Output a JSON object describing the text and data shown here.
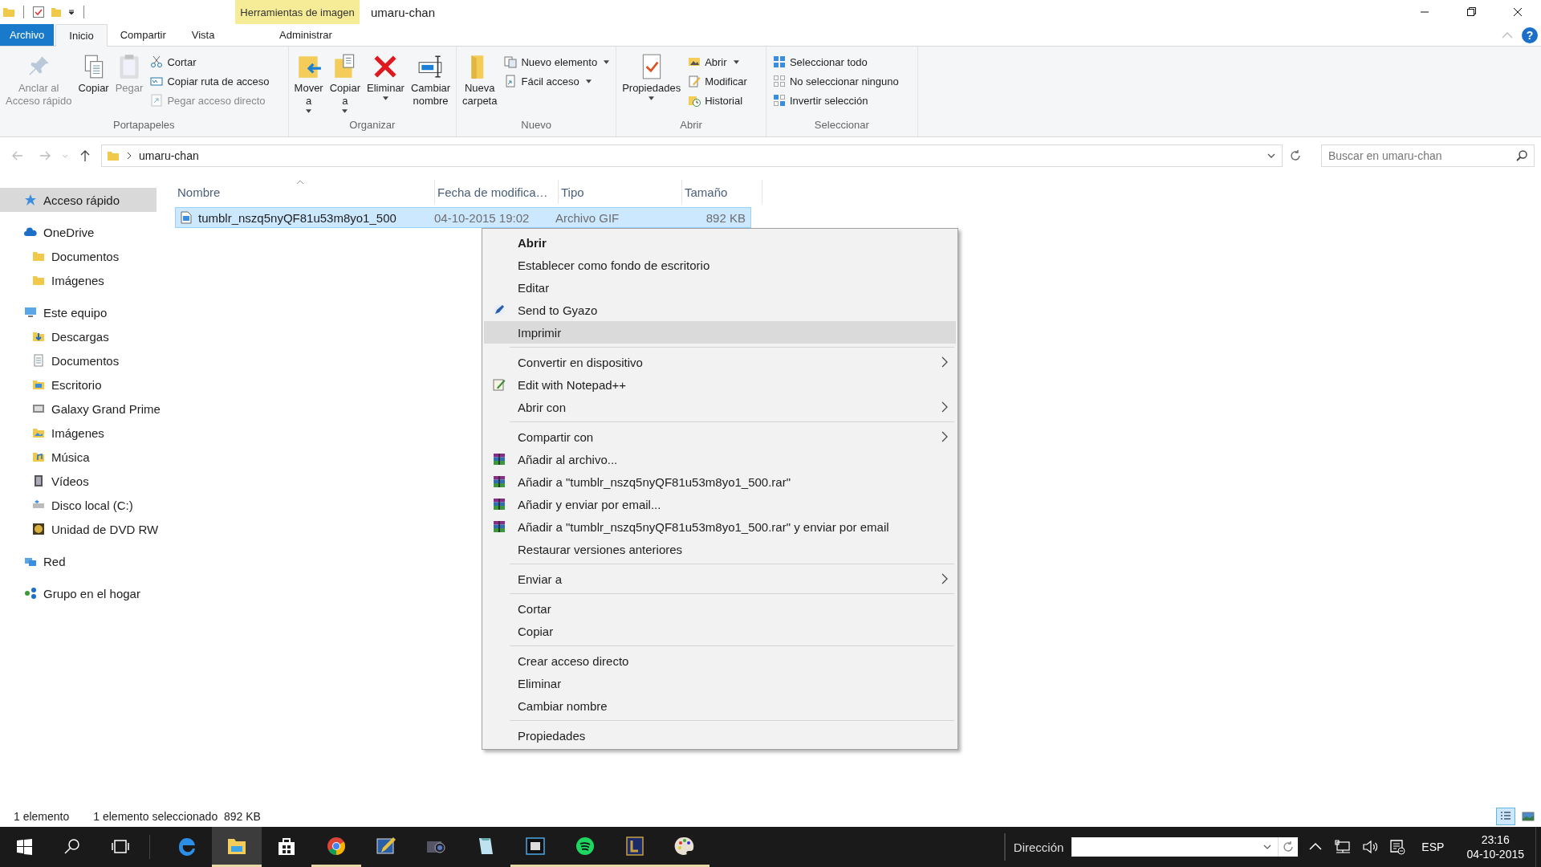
{
  "window": {
    "title": "umaru-chan",
    "context_tab_header": "Herramientas de imagen",
    "help_label": "?"
  },
  "ribbon_tabs": [
    {
      "label": "Archivo",
      "kind": "file",
      "selected": false
    },
    {
      "label": "Inicio",
      "kind": "tab",
      "selected": true
    },
    {
      "label": "Compartir",
      "kind": "tab",
      "selected": false
    },
    {
      "label": "Vista",
      "kind": "tab",
      "selected": false
    },
    {
      "label": "Administrar",
      "kind": "context",
      "selected": false
    }
  ],
  "ribbon_groups": [
    {
      "label": "Portapapeles",
      "large": [
        {
          "label": "Anclar al\nAcceso rápido",
          "disabled": true,
          "dropdown": false
        },
        {
          "label": "Copiar",
          "disabled": false,
          "dropdown": false
        },
        {
          "label": "Pegar",
          "disabled": true,
          "dropdown": false
        }
      ],
      "small": [
        {
          "label": "Cortar",
          "disabled": false,
          "dropdown": false
        },
        {
          "label": "Copiar ruta de acceso",
          "disabled": false,
          "dropdown": false
        },
        {
          "label": "Pegar acceso directo",
          "disabled": true,
          "dropdown": false
        }
      ]
    },
    {
      "label": "Organizar",
      "large": [
        {
          "label": "Mover\na",
          "disabled": false,
          "dropdown": true
        },
        {
          "label": "Copiar\na",
          "disabled": false,
          "dropdown": true
        },
        {
          "label": "Eliminar",
          "disabled": false,
          "dropdown": true
        },
        {
          "label": "Cambiar\nnombre",
          "disabled": false,
          "dropdown": false
        }
      ]
    },
    {
      "label": "Nuevo",
      "large": [
        {
          "label": "Nueva\ncarpeta",
          "disabled": false,
          "dropdown": false
        }
      ],
      "small": [
        {
          "label": "Nuevo elemento",
          "disabled": false,
          "dropdown": true
        },
        {
          "label": "Fácil acceso",
          "disabled": false,
          "dropdown": true
        }
      ]
    },
    {
      "label": "Abrir",
      "large": [
        {
          "label": "Propiedades",
          "disabled": false,
          "dropdown": true
        }
      ],
      "small": [
        {
          "label": "Abrir",
          "disabled": false,
          "dropdown": true
        },
        {
          "label": "Modificar",
          "disabled": false,
          "dropdown": false
        },
        {
          "label": "Historial",
          "disabled": false,
          "dropdown": false
        }
      ]
    },
    {
      "label": "Seleccionar",
      "small": [
        {
          "label": "Seleccionar todo",
          "disabled": false,
          "dropdown": false
        },
        {
          "label": "No seleccionar ninguno",
          "disabled": false,
          "dropdown": false
        },
        {
          "label": "Invertir selección",
          "disabled": false,
          "dropdown": false
        }
      ]
    }
  ],
  "address_bar": {
    "path": "umaru-chan",
    "search_placeholder": "Buscar en umaru-chan"
  },
  "sidebar": {
    "items": [
      {
        "label": "Acceso rápido",
        "selected": true
      },
      {
        "label": "OneDrive",
        "selected": false,
        "children": [
          {
            "label": "Documentos",
            "selected": false
          },
          {
            "label": "Imágenes",
            "selected": false
          }
        ]
      },
      {
        "label": "Este equipo",
        "selected": false,
        "children": [
          {
            "label": "Descargas",
            "selected": false
          },
          {
            "label": "Documentos",
            "selected": false
          },
          {
            "label": "Escritorio",
            "selected": false
          },
          {
            "label": "Galaxy Grand Prime",
            "selected": false
          },
          {
            "label": "Imágenes",
            "selected": false
          },
          {
            "label": "Música",
            "selected": false
          },
          {
            "label": "Vídeos",
            "selected": false
          },
          {
            "label": "Disco local (C:)",
            "selected": false
          },
          {
            "label": "Unidad de DVD RW",
            "selected": false
          }
        ]
      },
      {
        "label": "Red",
        "selected": false
      },
      {
        "label": "Grupo en el hogar",
        "selected": false
      }
    ]
  },
  "file_list": {
    "columns": [
      "Nombre",
      "Fecha de modifica…",
      "Tipo",
      "Tamaño"
    ],
    "rows": [
      {
        "name": "tumblr_nszq5nyQF81u53m8yo1_500",
        "date": "04-10-2015 19:02",
        "type": "Archivo GIF",
        "size": "892 KB",
        "selected": true
      }
    ]
  },
  "context_menu": [
    {
      "kind": "item",
      "label": "Abrir",
      "bold": true,
      "submenu": false,
      "highlighted": false
    },
    {
      "kind": "item",
      "label": "Establecer como fondo de escritorio",
      "bold": false,
      "submenu": false,
      "highlighted": false
    },
    {
      "kind": "item",
      "label": "Editar",
      "bold": false,
      "submenu": false,
      "highlighted": false
    },
    {
      "kind": "item",
      "label": "Send to Gyazo",
      "bold": false,
      "submenu": false,
      "highlighted": false
    },
    {
      "kind": "item",
      "label": "Imprimir",
      "bold": false,
      "submenu": false,
      "highlighted": true
    },
    {
      "kind": "separator"
    },
    {
      "kind": "item",
      "label": "Convertir en dispositivo",
      "bold": false,
      "submenu": true,
      "highlighted": false
    },
    {
      "kind": "item",
      "label": "Edit with Notepad++",
      "bold": false,
      "submenu": false,
      "highlighted": false
    },
    {
      "kind": "item",
      "label": "Abrir con",
      "bold": false,
      "submenu": true,
      "highlighted": false
    },
    {
      "kind": "separator"
    },
    {
      "kind": "item",
      "label": "Compartir con",
      "bold": false,
      "submenu": true,
      "highlighted": false
    },
    {
      "kind": "item",
      "label": "Añadir al archivo...",
      "bold": false,
      "submenu": false,
      "highlighted": false
    },
    {
      "kind": "item",
      "label": "Añadir a \"tumblr_nszq5nyQF81u53m8yo1_500.rar\"",
      "bold": false,
      "submenu": false,
      "highlighted": false
    },
    {
      "kind": "item",
      "label": "Añadir y enviar por email...",
      "bold": false,
      "submenu": false,
      "highlighted": false
    },
    {
      "kind": "item",
      "label": "Añadir a \"tumblr_nszq5nyQF81u53m8yo1_500.rar\" y enviar por email",
      "bold": false,
      "submenu": false,
      "highlighted": false
    },
    {
      "kind": "item",
      "label": "Restaurar versiones anteriores",
      "bold": false,
      "submenu": false,
      "highlighted": false
    },
    {
      "kind": "separator"
    },
    {
      "kind": "item",
      "label": "Enviar a",
      "bold": false,
      "submenu": true,
      "highlighted": false
    },
    {
      "kind": "separator"
    },
    {
      "kind": "item",
      "label": "Cortar",
      "bold": false,
      "submenu": false,
      "highlighted": false
    },
    {
      "kind": "item",
      "label": "Copiar",
      "bold": false,
      "submenu": false,
      "highlighted": false
    },
    {
      "kind": "separator"
    },
    {
      "kind": "item",
      "label": "Crear acceso directo",
      "bold": false,
      "submenu": false,
      "highlighted": false
    },
    {
      "kind": "item",
      "label": "Eliminar",
      "bold": false,
      "submenu": false,
      "highlighted": false
    },
    {
      "kind": "item",
      "label": "Cambiar nombre",
      "bold": false,
      "submenu": false,
      "highlighted": false
    },
    {
      "kind": "separator"
    },
    {
      "kind": "item",
      "label": "Propiedades",
      "bold": false,
      "submenu": false,
      "highlighted": false
    }
  ],
  "status_bar": {
    "count": "1 elemento",
    "selection": "1 elemento seleccionado  892 KB",
    "views": [
      {
        "kind": "details",
        "selected": true
      },
      {
        "kind": "large",
        "selected": false
      }
    ]
  },
  "taskbar": {
    "apps": [
      {
        "selected": false,
        "running": false
      },
      {
        "selected": true,
        "running": true
      },
      {
        "selected": false,
        "running": false
      },
      {
        "selected": false,
        "running": true
      },
      {
        "selected": false,
        "running": false
      },
      {
        "selected": false,
        "running": false
      },
      {
        "selected": false,
        "running": false
      },
      {
        "selected": false,
        "running": true
      },
      {
        "selected": false,
        "running": true
      },
      {
        "selected": false,
        "running": true
      },
      {
        "selected": false,
        "running": true
      }
    ],
    "address_label": "Dirección",
    "language": "ESP",
    "time": "23:16",
    "date": "04-10-2015"
  }
}
